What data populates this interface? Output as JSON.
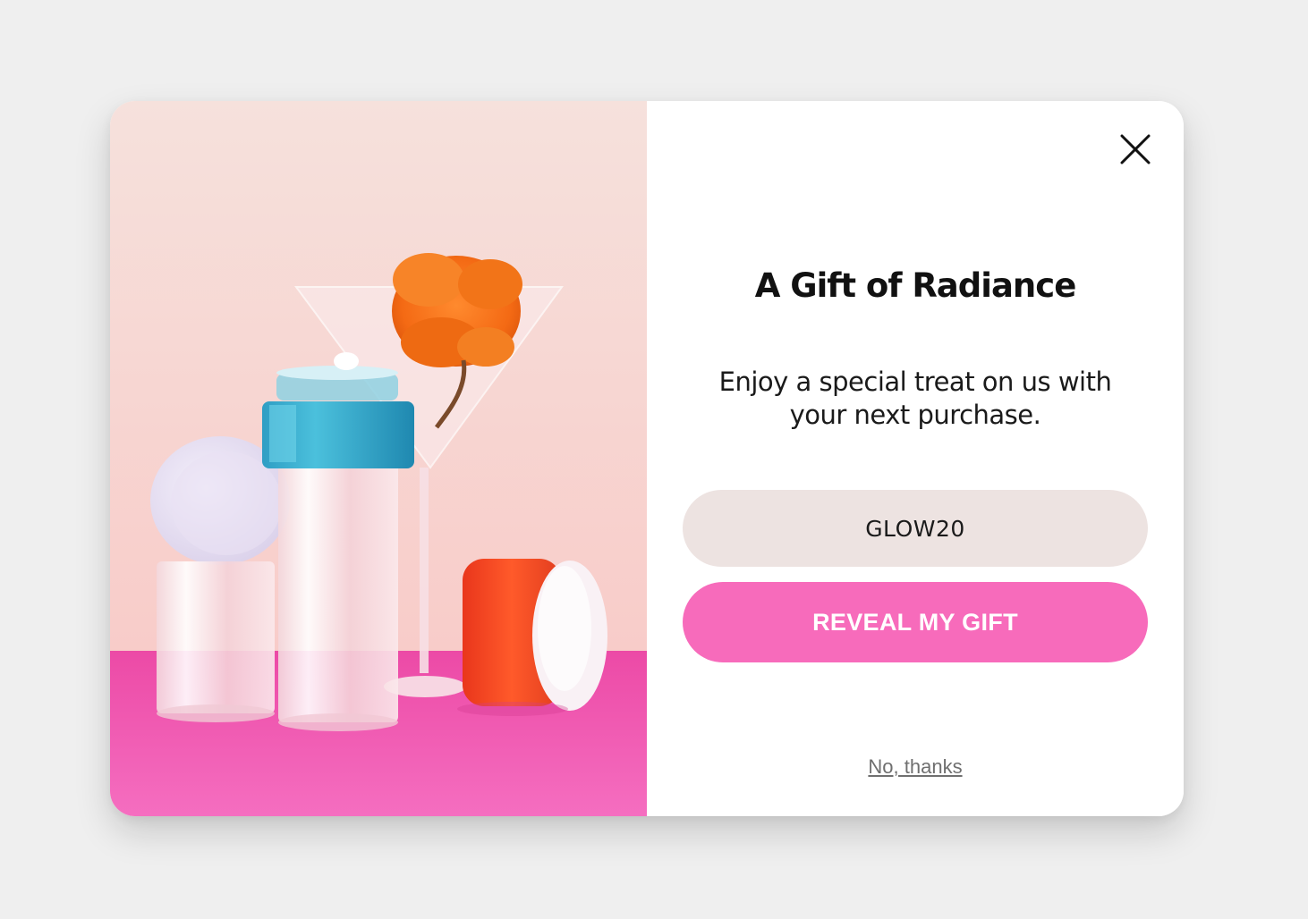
{
  "popup": {
    "title": "A Gift of Radiance",
    "subtitle": "Enjoy a special treat on us with your next purchase.",
    "code_value": "GLOW20",
    "reveal_label": "REVEAL MY GIFT",
    "dismiss_label": "No, thanks",
    "close_icon": "close-icon",
    "image_icon": "cosmetics-product-photo"
  },
  "colors": {
    "page_background": "#efefef",
    "accent_pink": "#f76bbb",
    "code_field_bg": "#ede3e1",
    "dismiss_text": "#6f6f6f"
  }
}
